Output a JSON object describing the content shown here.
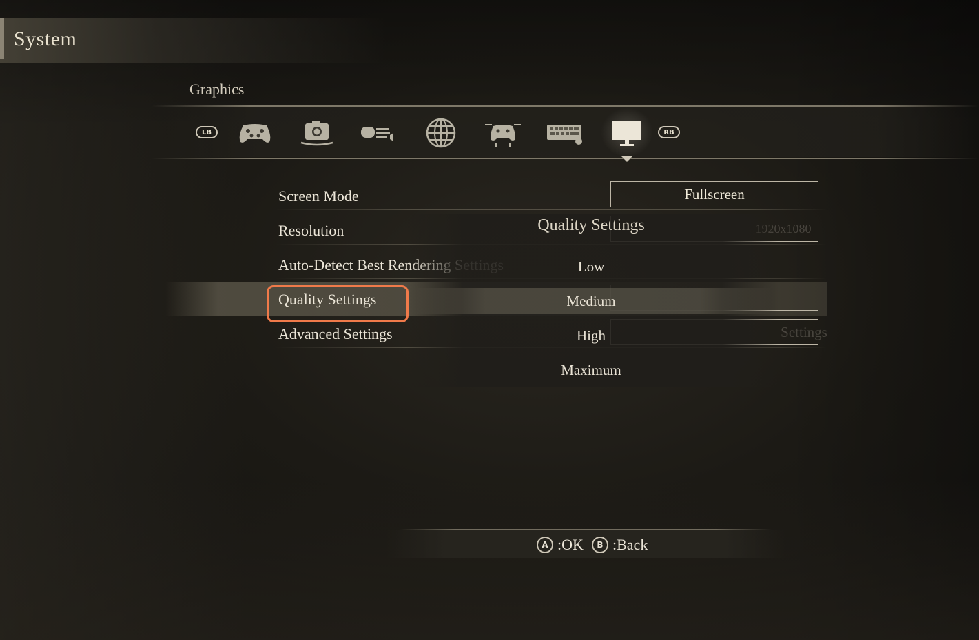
{
  "header": {
    "title": "System"
  },
  "section": {
    "title": "Graphics"
  },
  "tabs": {
    "left_bumper": "LB",
    "right_bumper": "RB",
    "icons": [
      "gamepad-icon",
      "camera-icon",
      "sound-icon",
      "globe-icon",
      "controller-config-icon",
      "keyboard-icon",
      "monitor-icon"
    ],
    "active": "monitor-icon"
  },
  "settings": {
    "rows": [
      {
        "label": "Screen Mode",
        "value": "Fullscreen"
      },
      {
        "label": "Resolution",
        "value": "1920x1080"
      },
      {
        "label": "Auto-Detect Best Rendering Settings",
        "value": ""
      },
      {
        "label": "Quality Settings",
        "value": ""
      },
      {
        "label": "Advanced Settings",
        "value": "Settings"
      }
    ]
  },
  "dropdown": {
    "title": "Quality Settings",
    "options": [
      "Low",
      "Medium",
      "High",
      "Maximum"
    ],
    "selected": "Medium"
  },
  "footer": {
    "ok_button": "A",
    "ok_label": ":OK",
    "back_button": "B",
    "back_label": ":Back"
  },
  "colors": {
    "highlight": "#f07a4a",
    "text": "#ece6d8"
  }
}
